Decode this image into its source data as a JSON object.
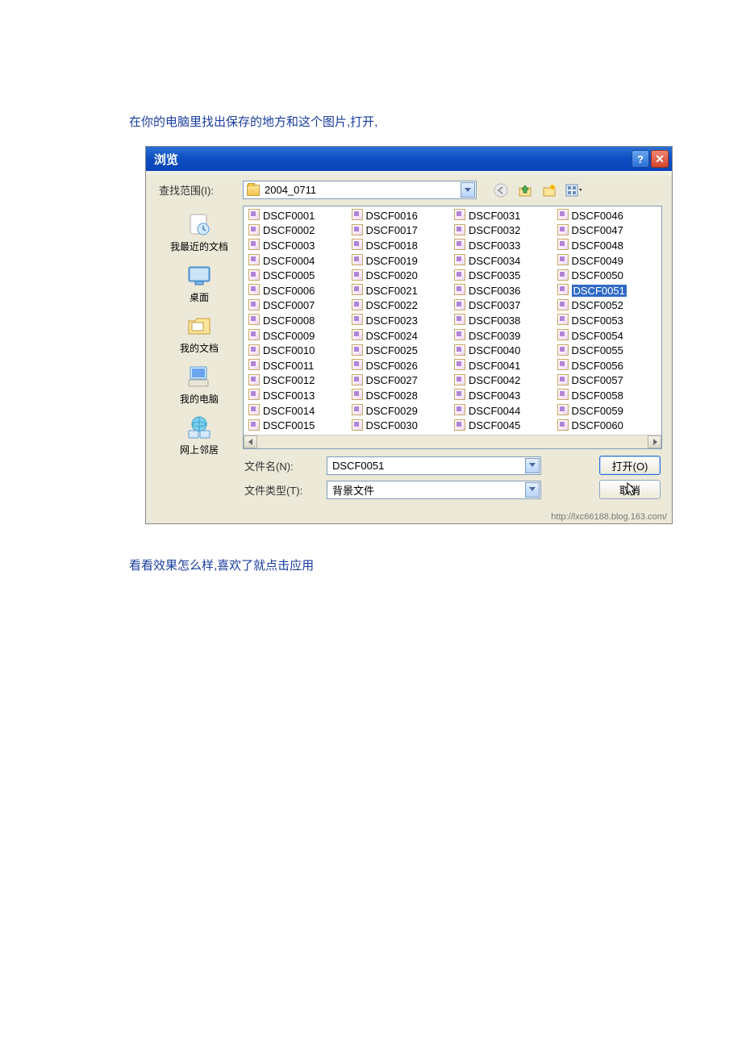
{
  "captions": {
    "above": "在你的电脑里找出保存的地方和这个图片,打开,",
    "below": "看看效果怎么样,喜欢了就点击应用"
  },
  "dialog": {
    "title": "浏览",
    "look_in_label": "查找范围(I):",
    "folder_name": "2004_0711",
    "places": {
      "recent": "我最近的文档",
      "desktop": "桌面",
      "mydocs": "我的文档",
      "mycomputer": "我的电脑",
      "network": "网上邻居"
    },
    "filename_label": "文件名(N):",
    "filename_value": "DSCF0051",
    "filetype_label": "文件类型(T):",
    "filetype_value": "背景文件",
    "open_btn": "打开(O)",
    "cancel_btn": "取消",
    "selected_file": "DSCF0051",
    "files_col1": [
      "DSCF0001",
      "DSCF0002",
      "DSCF0003",
      "DSCF0004",
      "DSCF0005",
      "DSCF0006",
      "DSCF0007",
      "DSCF0008",
      "DSCF0009",
      "DSCF0010",
      "DSCF0011",
      "DSCF0012",
      "DSCF0013",
      "DSCF0014",
      "DSCF0015"
    ],
    "files_col2": [
      "DSCF0016",
      "DSCF0017",
      "DSCF0018",
      "DSCF0019",
      "DSCF0020",
      "DSCF0021",
      "DSCF0022",
      "DSCF0023",
      "DSCF0024",
      "DSCF0025",
      "DSCF0026",
      "DSCF0027",
      "DSCF0028",
      "DSCF0029",
      "DSCF0030"
    ],
    "files_col3": [
      "DSCF0031",
      "DSCF0032",
      "DSCF0033",
      "DSCF0034",
      "DSCF0035",
      "DSCF0036",
      "DSCF0037",
      "DSCF0038",
      "DSCF0039",
      "DSCF0040",
      "DSCF0041",
      "DSCF0042",
      "DSCF0043",
      "DSCF0044",
      "DSCF0045"
    ],
    "files_col4": [
      "DSCF0046",
      "DSCF0047",
      "DSCF0048",
      "DSCF0049",
      "DSCF0050",
      "DSCF0051",
      "DSCF0052",
      "DSCF0053",
      "DSCF0054",
      "DSCF0055",
      "DSCF0056",
      "DSCF0057",
      "DSCF0058",
      "DSCF0059",
      "DSCF0060"
    ]
  },
  "watermark": "http://lxc66188.blog.163.com/"
}
